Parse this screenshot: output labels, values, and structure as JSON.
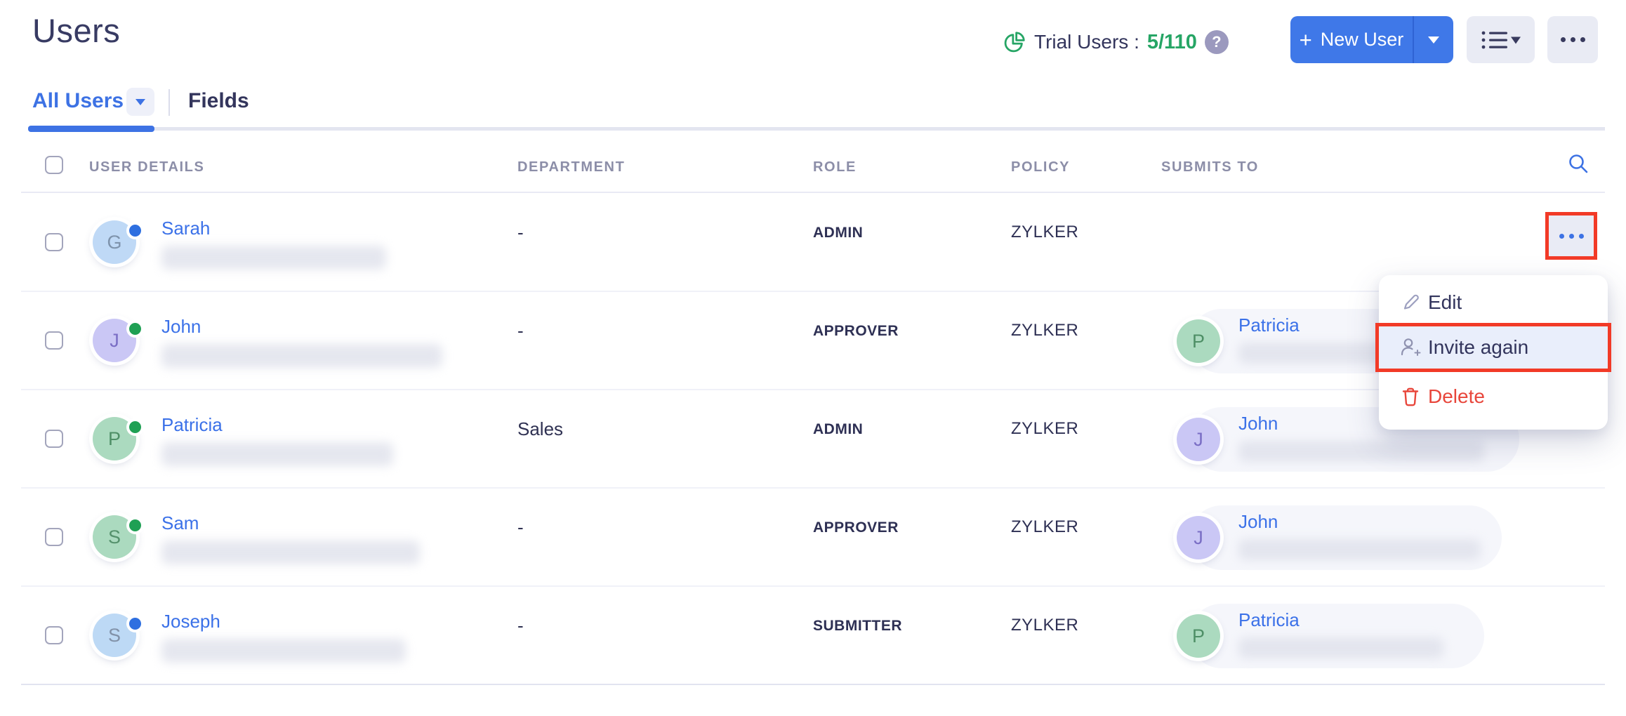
{
  "page": {
    "title": "Users"
  },
  "header": {
    "trial": {
      "label": "Trial Users :",
      "value": "5/110",
      "help": "?"
    },
    "new_user_button": {
      "plus": "+",
      "label": "New User"
    }
  },
  "tabs": {
    "all_users": "All Users",
    "fields": "Fields"
  },
  "table": {
    "columns": [
      "USER DETAILS",
      "DEPARTMENT",
      "ROLE",
      "POLICY",
      "SUBMITS TO"
    ],
    "rows": [
      {
        "name": "Sarah",
        "initial": "G",
        "avatar_bg": "#BFD9F6",
        "avatar_fg": "#7E93AC",
        "dot": "#2E6FE0",
        "department": "-",
        "role": "ADMIN",
        "policy": "ZYLKER",
        "email_redacted": true,
        "blur_width": 320,
        "submits_to": null,
        "has_open_menu": true
      },
      {
        "name": "John",
        "initial": "J",
        "avatar_bg": "#CAC7F5",
        "avatar_fg": "#7A6EC5",
        "dot": "#1FA054",
        "department": "-",
        "role": "APPROVER",
        "policy": "ZYLKER",
        "email_redacted": true,
        "blur_width": 400,
        "submits_to": {
          "name": "Patricia",
          "initial": "P",
          "avatar_bg": "#ABDABF",
          "avatar_fg": "#4E8F66",
          "blur_width": 288,
          "pill_width": 330
        }
      },
      {
        "name": "Patricia",
        "initial": "P",
        "avatar_bg": "#ABDABF",
        "avatar_fg": "#4E8F66",
        "dot": "#1FA054",
        "department": "Sales",
        "role": "ADMIN",
        "policy": "ZYLKER",
        "email_redacted": true,
        "blur_width": 330,
        "submits_to": {
          "name": "John",
          "initial": "J",
          "avatar_bg": "#CAC7F5",
          "avatar_fg": "#7A6EC5",
          "blur_width": 350,
          "pill_width": 470
        }
      },
      {
        "name": "Sam",
        "initial": "S",
        "avatar_bg": "#ABDABF",
        "avatar_fg": "#55916C",
        "dot": "#1FA054",
        "department": "-",
        "role": "APPROVER",
        "policy": "ZYLKER",
        "email_redacted": true,
        "blur_width": 368,
        "submits_to": {
          "name": "John",
          "initial": "J",
          "avatar_bg": "#CAC7F5",
          "avatar_fg": "#7A6EC5",
          "blur_width": 345,
          "pill_width": 445
        }
      },
      {
        "name": "Joseph",
        "initial": "S",
        "avatar_bg": "#BDD9F5",
        "avatar_fg": "#8292A9",
        "dot": "#2E6FE0",
        "department": "-",
        "role": "SUBMITTER",
        "policy": "ZYLKER",
        "email_redacted": true,
        "blur_width": 348,
        "submits_to": {
          "name": "Patricia",
          "initial": "P",
          "avatar_bg": "#ABDABF",
          "avatar_fg": "#4E8F66",
          "blur_width": 292,
          "pill_width": 420
        }
      }
    ]
  },
  "row_menu": {
    "items": [
      {
        "label": "Edit"
      },
      {
        "label": "Invite again",
        "highlighted": true
      },
      {
        "label": "Delete",
        "danger": true
      }
    ]
  },
  "colors": {
    "accent_blue": "#3D72E4",
    "brand_green": "#26A565",
    "highlight_red": "#F23A27",
    "danger_red": "#E8463B",
    "status_online_green": "#1FA054",
    "status_invited_blue": "#2E6FE0"
  }
}
